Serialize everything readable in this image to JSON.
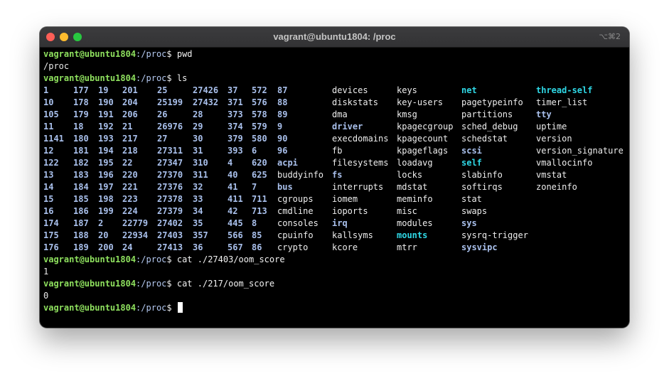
{
  "window": {
    "title": "vagrant@ubuntu1804: /proc",
    "shortcut": "⌥⌘2"
  },
  "colors": {
    "prompt_user": "#8ee05e",
    "prompt_path": "#b3c8f0",
    "directory": "#a9c0ec",
    "symlink": "#2fd8e6",
    "file": "#ededed",
    "background": "#000000"
  },
  "prompt": {
    "user_host": "vagrant@ubuntu1804",
    "path": ":/proc",
    "symbol": "$ "
  },
  "session": {
    "cmd1": "pwd",
    "out1": "/proc",
    "cmd2": "ls",
    "cmd3": "cat ./27403/oom_score",
    "out3": "1",
    "cmd4": "cat ./217/oom_score",
    "out4": "0",
    "cmd5": ""
  },
  "ls_columns": [
    [
      "1",
      "10",
      "105",
      "11",
      "1141",
      "12",
      "122",
      "13",
      "14",
      "15",
      "16",
      "174",
      "175",
      "176"
    ],
    [
      "177",
      "178",
      "179",
      "18",
      "180",
      "181",
      "182",
      "183",
      "184",
      "185",
      "186",
      "187",
      "188",
      "189"
    ],
    [
      "19",
      "190",
      "191",
      "192",
      "193",
      "194",
      "195",
      "196",
      "197",
      "198",
      "199",
      "2",
      "20",
      "200"
    ],
    [
      "201",
      "204",
      "206",
      "21",
      "217",
      "218",
      "22",
      "220",
      "221",
      "223",
      "224",
      "22779",
      "22934",
      "24"
    ],
    [
      "25",
      "25199",
      "26",
      "26976",
      "27",
      "27311",
      "27347",
      "27370",
      "27376",
      "27378",
      "27379",
      "27402",
      "27403",
      "27413"
    ],
    [
      "27426",
      "27432",
      "28",
      "29",
      "30",
      "31",
      "310",
      "311",
      "32",
      "33",
      "34",
      "35",
      "357",
      "36"
    ],
    [
      "37",
      "371",
      "373",
      "374",
      "379",
      "393",
      "4",
      "40",
      "41",
      "411",
      "42",
      "445",
      "566",
      "567"
    ],
    [
      "572",
      "576",
      "578",
      "579",
      "580",
      "6",
      "620",
      "625",
      "7",
      "711",
      "713",
      "8",
      "85",
      "86"
    ],
    [
      "87",
      "88",
      "89",
      "9",
      "90",
      "96",
      "acpi",
      "buddyinfo",
      "bus",
      "cgroups",
      "cmdline",
      "consoles",
      "cpuinfo",
      "crypto"
    ],
    [
      "devices",
      "diskstats",
      "dma",
      "driver",
      "execdomains",
      "fb",
      "filesystems",
      "fs",
      "interrupts",
      "iomem",
      "ioports",
      "irq",
      "kallsyms",
      "kcore"
    ],
    [
      "keys",
      "key-users",
      "kmsg",
      "kpagecgroup",
      "kpagecount",
      "kpageflags",
      "loadavg",
      "locks",
      "mdstat",
      "meminfo",
      "misc",
      "modules",
      "mounts",
      "mtrr"
    ],
    [
      "net",
      "pagetypeinfo",
      "partitions",
      "sched_debug",
      "schedstat",
      "scsi",
      "self",
      "slabinfo",
      "softirqs",
      "stat",
      "swaps",
      "sys",
      "sysrq-trigger",
      "sysvipc"
    ],
    [
      "thread-self",
      "timer_list",
      "tty",
      "uptime",
      "version",
      "version_signature",
      "vmallocinfo",
      "vmstat",
      "zoneinfo"
    ]
  ],
  "ls_directories": [
    "acpi",
    "bus",
    "driver",
    "fs",
    "irq",
    "scsi",
    "sys",
    "sysvipc",
    "tty"
  ],
  "ls_symlinks": [
    "net",
    "self",
    "thread-self",
    "mounts"
  ]
}
